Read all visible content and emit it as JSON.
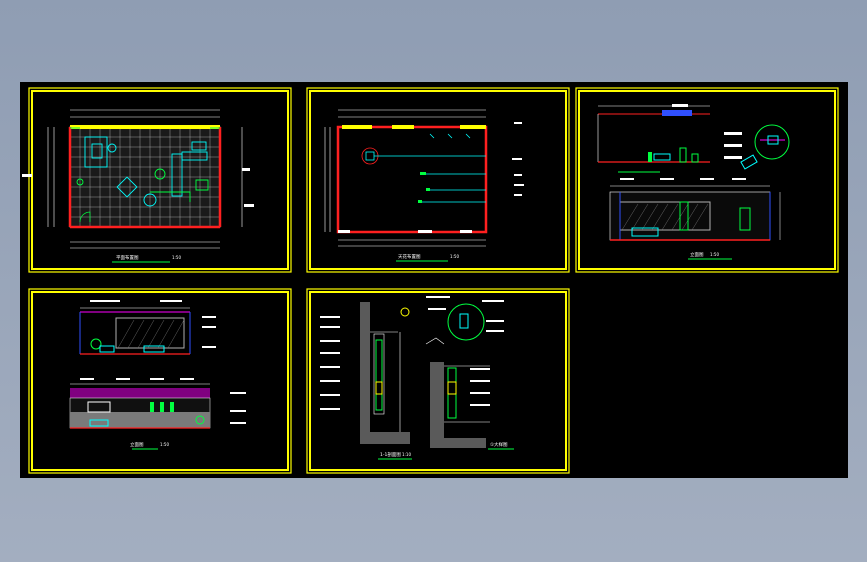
{
  "colors": {
    "background": "#98a4b8",
    "modelspace": "#000000",
    "frame": "#ffff00",
    "wall": "#ff2020",
    "furniture": "#00ffff",
    "plant": "#00ff40",
    "dimension": "#ffffff",
    "hatch": "#b0b0b0",
    "accent": "#ff00ff",
    "blue": "#3050ff"
  },
  "sheets": [
    {
      "id": "sheet-1",
      "title": "平面布置图",
      "scale": "1:50"
    },
    {
      "id": "sheet-2",
      "title": "天花布置图",
      "scale": "1:50"
    },
    {
      "id": "sheet-3",
      "title": "立面图",
      "scale": "1:50"
    },
    {
      "id": "sheet-4",
      "title": "立面图",
      "scale": "1:50"
    },
    {
      "id": "sheet-5",
      "title": "1-1剖面图",
      "scale": "1:10",
      "title2": "①大样图"
    }
  ]
}
